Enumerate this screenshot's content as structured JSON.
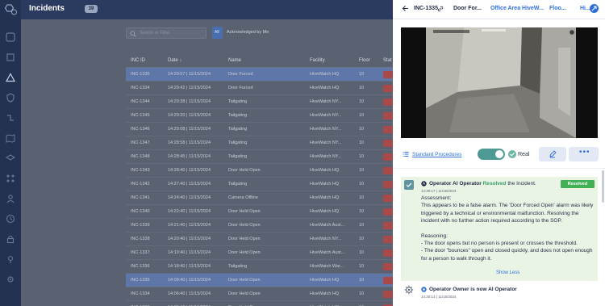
{
  "app": {
    "title": "Incidents",
    "count": "39"
  },
  "sidebar": {
    "items": [
      "grid-icon",
      "calendar-icon",
      "alert-icon",
      "shield-icon",
      "route-icon",
      "map-icon",
      "layers-icon",
      "network-icon",
      "users-icon",
      "history-icon",
      "lock-icon",
      "pin-icon",
      "settings-icon"
    ]
  },
  "list": {
    "search_placeholder": "Search or Filter",
    "filter_label": "All",
    "acknowledged_label": "Acknowledged by Me",
    "headers": {
      "id": "INC ID",
      "date": "Date ↓",
      "name": "Name",
      "facility": "Facility",
      "floor": "Floor",
      "status": "Stat"
    },
    "rows": [
      {
        "id": "INC-1335",
        "date": "14:29:57 | 11/15/2024",
        "name": "Door Forced",
        "facility": "HiveWatch HQ",
        "floor": "10",
        "selected": true
      },
      {
        "id": "INC-1334",
        "date": "14:29:42 | 11/15/2024",
        "name": "Door Forced",
        "facility": "HiveWatch HQ",
        "floor": "10"
      },
      {
        "id": "INC-1344",
        "date": "14:29:38 | 11/15/2024",
        "name": "Tailgating",
        "facility": "HiveWatch NY...",
        "floor": "10"
      },
      {
        "id": "INC-1345",
        "date": "14:29:20 | 11/15/2024",
        "name": "Tailgating",
        "facility": "HiveWatch NY...",
        "floor": "10"
      },
      {
        "id": "INC-1346",
        "date": "14:29:08 | 11/15/2024",
        "name": "Tailgating",
        "facility": "HiveWatch NY...",
        "floor": "10"
      },
      {
        "id": "INC-1347",
        "date": "14:28:58 | 11/15/2024",
        "name": "Tailgating",
        "facility": "HiveWatch NY...",
        "floor": "10"
      },
      {
        "id": "INC-1348",
        "date": "14:28:45 | 11/15/2024",
        "name": "Tailgating",
        "facility": "HiveWatch NY...",
        "floor": "10"
      },
      {
        "id": "INC-1343",
        "date": "14:28:40 | 11/15/2024",
        "name": "Door Held Open",
        "facility": "HiveWatch HQ",
        "floor": "10"
      },
      {
        "id": "INC-1342",
        "date": "14:27:40 | 11/15/2024",
        "name": "Tailgating",
        "facility": "HiveWatch HQ",
        "floor": "10"
      },
      {
        "id": "INC-1341",
        "date": "14:24:40 | 11/15/2024",
        "name": "Camera Offline",
        "facility": "HiveWatch HQ",
        "floor": "10"
      },
      {
        "id": "INC-1340",
        "date": "14:22:40 | 11/15/2024",
        "name": "Door Held Open",
        "facility": "HiveWatch HQ",
        "floor": "10"
      },
      {
        "id": "INC-1339",
        "date": "14:21:40 | 11/15/2024",
        "name": "Door Held Open",
        "facility": "HiveWatch Aust...",
        "floor": "10"
      },
      {
        "id": "INC-1338",
        "date": "14:20:40 | 11/15/2024",
        "name": "Door Held Open",
        "facility": "HiveWatch NY...",
        "floor": "10"
      },
      {
        "id": "INC-1337",
        "date": "14:19:40 | 11/15/2024",
        "name": "Door Held Open",
        "facility": "HiveWatch Aust...",
        "floor": "10"
      },
      {
        "id": "INC-1336",
        "date": "14:18:40 | 11/15/2024",
        "name": "Tailgating",
        "facility": "HiveWatch War...",
        "floor": "10"
      },
      {
        "id": "INC-1335",
        "date": "14:09:40 | 11/15/2024",
        "name": "Door Held Open",
        "facility": "HiveWatch HQ",
        "floor": "10",
        "selected": true
      },
      {
        "id": "INC-1334",
        "date": "14:06:40 | 11/15/2024",
        "name": "Door Held Open",
        "facility": "HiveWatch HQ",
        "floor": "10"
      },
      {
        "id": "INC-1333",
        "date": "14:05:40 | 11/15/2024",
        "name": "Door Held Open",
        "facility": "HiveWatch HQ",
        "floor": "10"
      }
    ]
  },
  "detail": {
    "incident_id": "INC-1335",
    "tabs": [
      "Door For...",
      "Office Area HiveW...",
      "Floo...",
      "Hi..."
    ],
    "standard_procedures": "Standard Procedures",
    "real_label": "Real",
    "more_label": "•••",
    "event1": {
      "actor": "Operator AI Operator",
      "action": "Resolved",
      "object": "the Incident.",
      "timestamp": "14:30:17 | 11/15/2024",
      "badge": "Resolved",
      "assessment_title": "Assessment:",
      "assessment": "This appears to be a false alarm. The 'Door Forced Open' alarm was likely triggered by a technical or environmental malfunction. Resolving the incident with no further action required according to the SOP.",
      "reasoning_title": "Reasoning:",
      "reasoning_1": "- The door opens but no person is present or crosses the threshold.",
      "reasoning_2": "- The door \"bounces\" open and closed quickly, and does not open enough for a person to walk through it.",
      "show_less": "Show Less"
    },
    "event2": {
      "text": "Operator Owner is now AI Operator",
      "timestamp": "14:30:13 | 11/15/2024"
    }
  },
  "colors": {
    "accent": "#2f6fd6",
    "resolved": "#43b056",
    "rail": "#243252"
  }
}
